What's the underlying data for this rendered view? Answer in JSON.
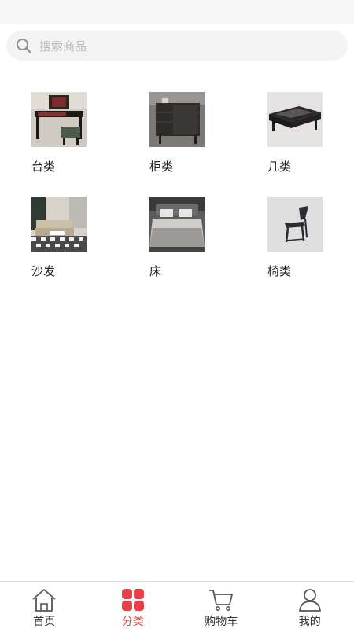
{
  "search": {
    "placeholder": "搜索商品",
    "icon": "search-icon"
  },
  "categories": [
    {
      "label": "台类",
      "icon": "desk-thumbnail"
    },
    {
      "label": "柜类",
      "icon": "cabinet-thumbnail"
    },
    {
      "label": "几类",
      "icon": "coffee-table-thumbnail"
    },
    {
      "label": "沙发",
      "icon": "sofa-thumbnail"
    },
    {
      "label": "床",
      "icon": "bed-thumbnail"
    },
    {
      "label": "椅类",
      "icon": "chair-thumbnail"
    }
  ],
  "tabs": [
    {
      "label": "首页",
      "icon": "home-icon",
      "active": false
    },
    {
      "label": "分类",
      "icon": "category-icon",
      "active": true
    },
    {
      "label": "购物车",
      "icon": "cart-icon",
      "active": false
    },
    {
      "label": "我的",
      "icon": "user-icon",
      "active": false
    }
  ],
  "colors": {
    "accent": "#ea3f48",
    "search_bg": "#f3f3f3",
    "placeholder": "#b8b8b8"
  }
}
